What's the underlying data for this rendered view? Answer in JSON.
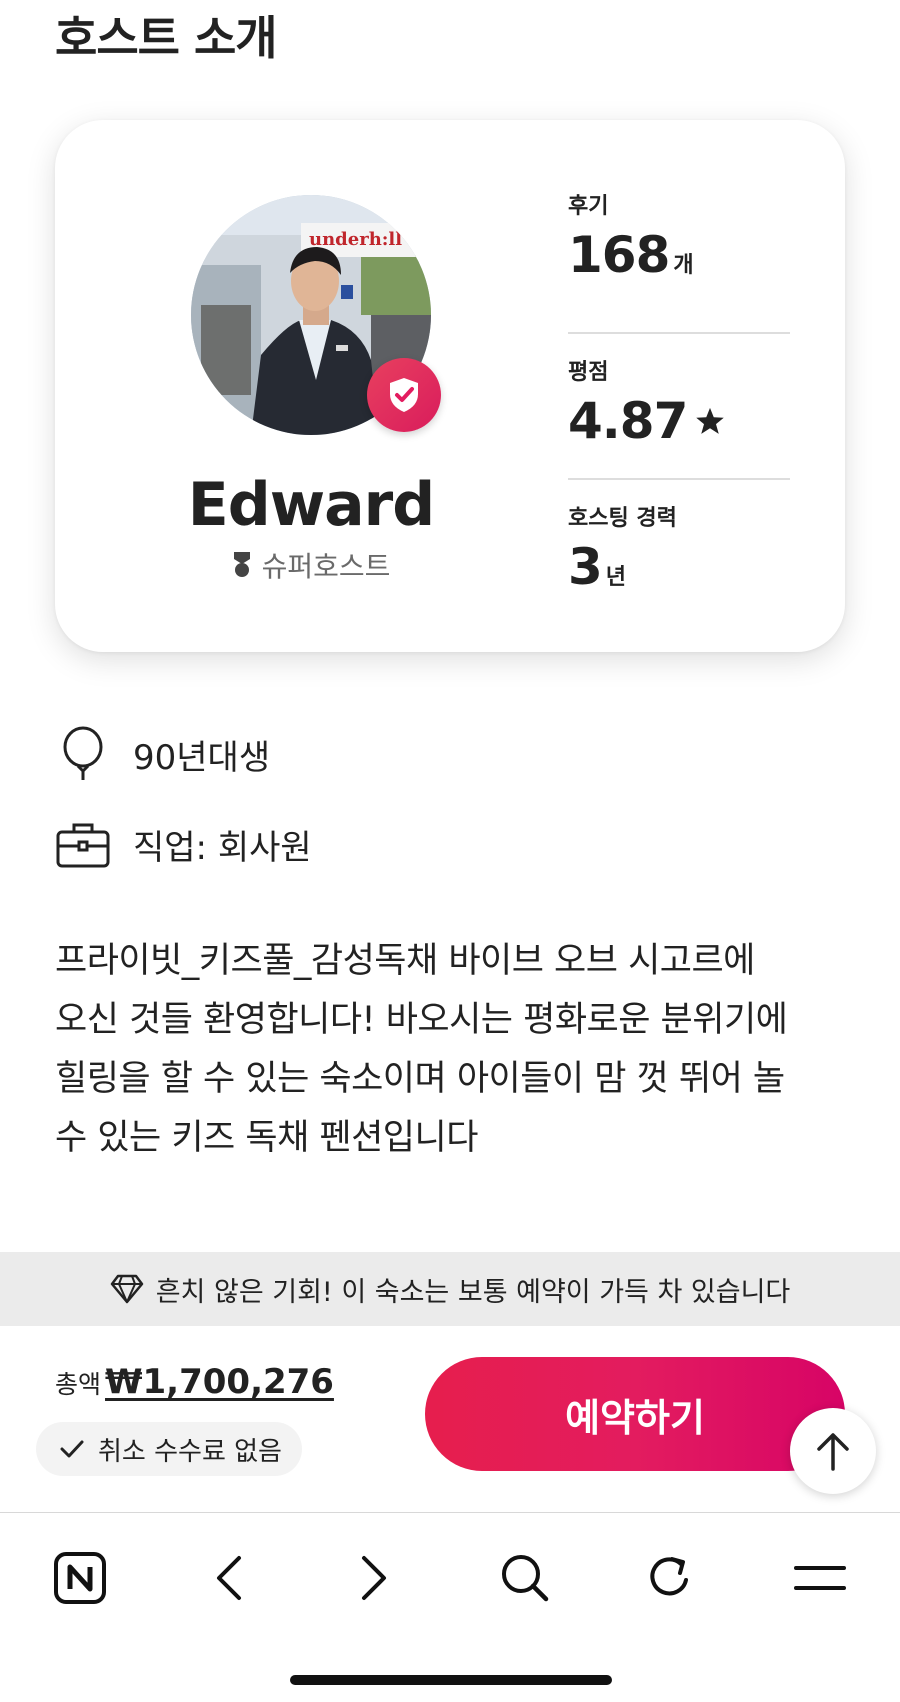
{
  "section": {
    "title": "호스트 소개"
  },
  "host": {
    "name": "Edward",
    "badge_label": "슈퍼호스트",
    "photo_sign_text": "underh:ll"
  },
  "stats": [
    {
      "label": "후기",
      "value": "168",
      "unit": "개"
    },
    {
      "label": "평점",
      "value": "4.87",
      "unit": ""
    },
    {
      "label": "호스팅 경력",
      "value": "3",
      "unit": "년"
    }
  ],
  "info": {
    "birth": "90년대생",
    "job": "직업: 회사원"
  },
  "description": {
    "lines": [
      "프라이빗_키즈풀_감성독채 바이브 오브 시고르에",
      "오신 것들 환영합니다! 바오시는 평화로운 분위기에",
      "힐링을 할 수 있는 숙소이며 아이들이 맘 껏 뛰어 놀",
      "수 있는 키즈 독채 펜션입니다"
    ]
  },
  "notice": {
    "text": "흔치 않은 기회! 이 숙소는 보통 예약이 가득 차 있습니다"
  },
  "booking": {
    "total_label": "총액",
    "total_price": "₩1,700,276",
    "fee_chip": "취소 수수료 없음",
    "reserve_label": "예약하기"
  },
  "icons": {
    "verified": "shield-check-icon",
    "superhost": "medal-icon",
    "rating": "star-icon",
    "birth": "balloon-icon",
    "job": "briefcase-icon",
    "notice": "diamond-icon",
    "fee": "check-icon",
    "scroll_top": "arrow-up-icon",
    "toolbar": [
      "naver-home-icon",
      "back-icon",
      "forward-icon",
      "search-icon",
      "refresh-icon",
      "menu-icon"
    ]
  },
  "colors": {
    "accent": "#E31C5F",
    "text": "#222222",
    "muted": "#6A6A6A",
    "banner_bg": "#EBEBEB"
  }
}
